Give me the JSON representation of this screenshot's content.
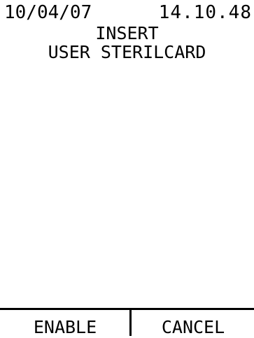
{
  "status_bar": {
    "date": "10/04/07",
    "time": "14.10.48"
  },
  "message": {
    "line1": "INSERT",
    "line2": "USER STERILCARD"
  },
  "softkeys": {
    "left_label": "ENABLE",
    "right_label": "CANCEL"
  },
  "colors": {
    "background": "#ffffff",
    "foreground": "#000000"
  }
}
